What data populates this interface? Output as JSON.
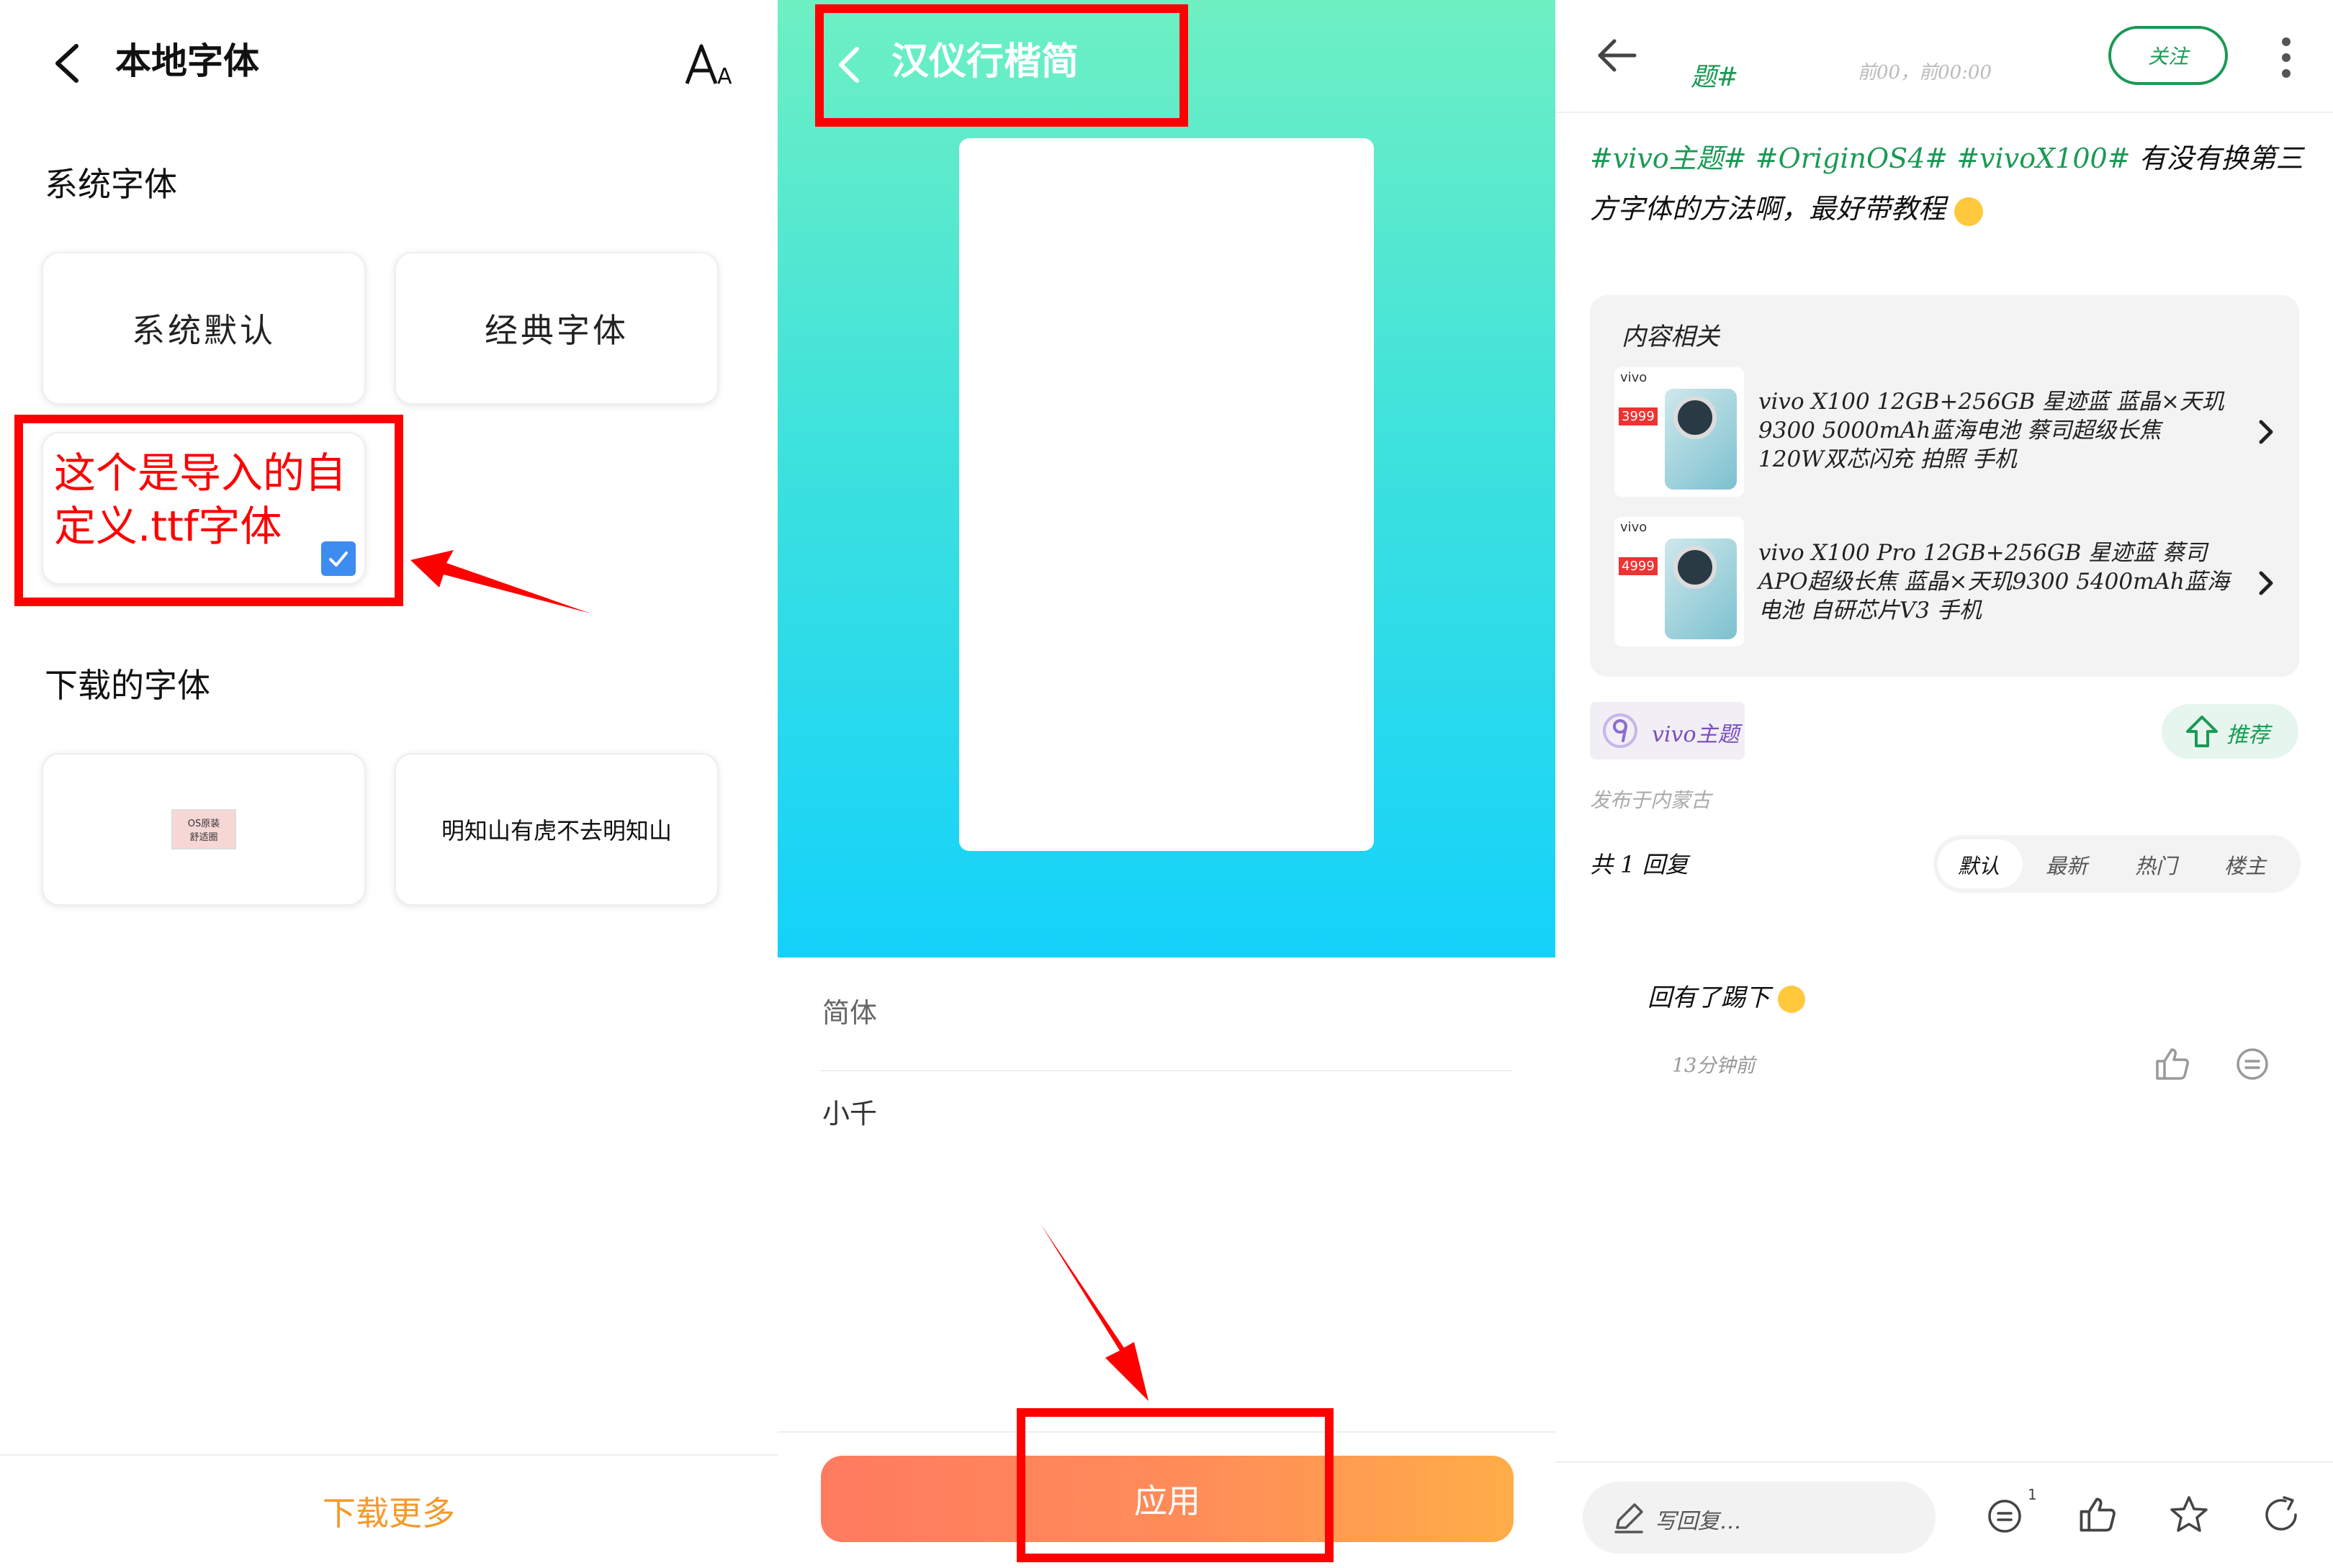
{
  "left": {
    "title": "本地字体",
    "font_size_icon": "font-size-icon",
    "system_section": "系统字体",
    "system_cards": [
      "系统默认",
      "经典字体"
    ],
    "annotation": "这个是导入的自定义.ttf字体",
    "downloaded_section": "下载的字体",
    "downloaded_sample": "明知山有虎不去明知山",
    "badge_text": [
      "OS原装",
      "舒适圈"
    ],
    "download_more": "下载更多",
    "colors": {
      "annotation": "#ff0000",
      "accent": "#f39a2c",
      "check": "#3d8cf0"
    }
  },
  "mid": {
    "title": "汉仪行楷简",
    "variant": "简体",
    "author": "小千",
    "apply_button": "应用",
    "colors": {
      "gradient_top": "#6ef0c2",
      "gradient_bottom": "#14d2fb",
      "apply_start": "#ff7b60",
      "apply_end": "#ffad48"
    }
  },
  "right": {
    "header_tag": "题#",
    "header_meta": "前00，前00:00",
    "follow_button": "关注",
    "post_tags": [
      "#vivo主题#",
      "#OriginOS4#",
      "#vivoX100#"
    ],
    "post_text": "有没有换第三方字体的方法啊，最好带教程",
    "related_title": "内容相关",
    "products": [
      {
        "brand": "vivo",
        "price": "3999",
        "text": "vivo X100 12GB+256GB 星迹蓝 蓝晶×天玑9300 5000mAh蓝海电池 蔡司超级长焦 120W双芯闪充 拍照 手机"
      },
      {
        "brand": "vivo",
        "price": "4999",
        "text": "vivo X100 Pro 12GB+256GB 星迹蓝 蔡司APO超级长焦 蓝晶×天玑9300 5400mAh蓝海电池 自研芯片V3 手机"
      }
    ],
    "topic_chip": "vivo主题",
    "recommend": "推荐",
    "location": "发布于内蒙古",
    "reply_count": "共 1 回复",
    "sort_tabs": [
      "默认",
      "最新",
      "热门",
      "楼主"
    ],
    "comment_text": "回有了踢下",
    "comment_time": "13分钟前",
    "reply_placeholder": "写回复…",
    "comment_badge": "1",
    "colors": {
      "green": "#1a9a55",
      "purple": "#7a4dbb"
    }
  }
}
